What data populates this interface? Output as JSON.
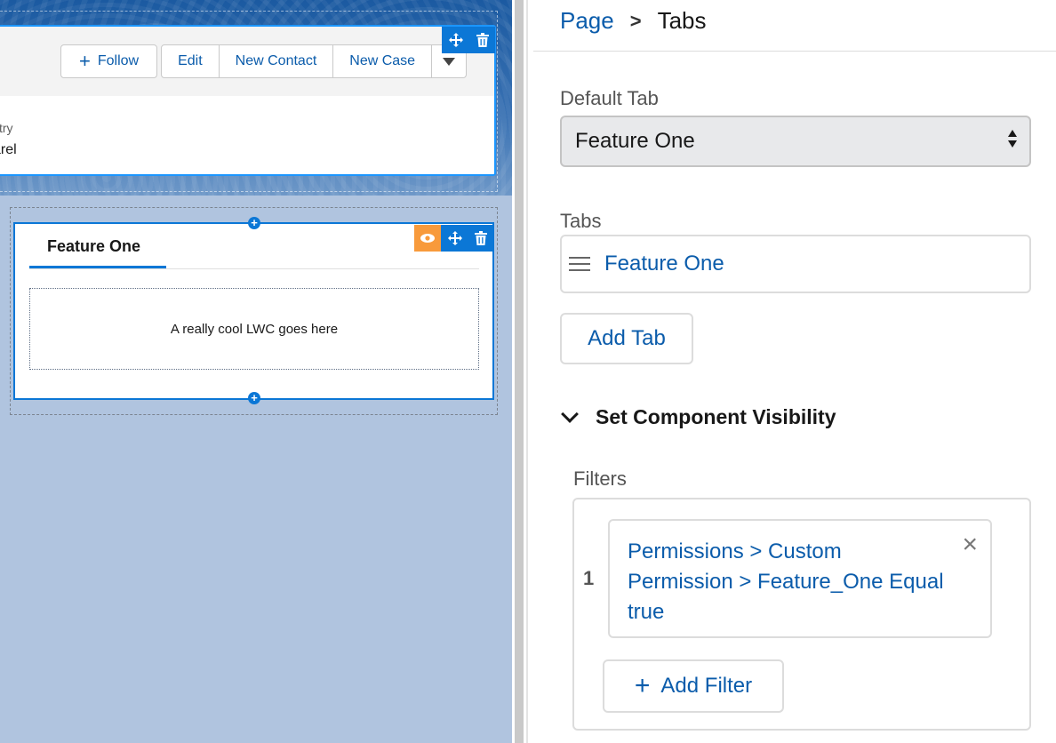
{
  "record_header": {
    "follow_label": "Follow",
    "edit_label": "Edit",
    "new_contact_label": "New Contact",
    "new_case_label": "New Case",
    "field_label": "stry",
    "field_value": "arel"
  },
  "tabs_component": {
    "tab_label": "Feature One",
    "placeholder_text": "A really cool LWC goes here"
  },
  "panel": {
    "breadcrumb": {
      "parent": "Page",
      "separator": ">",
      "current": "Tabs"
    },
    "default_tab": {
      "label": "Default Tab",
      "value": "Feature One"
    },
    "tabs": {
      "label": "Tabs",
      "items": [
        "Feature One"
      ],
      "add_label": "Add Tab"
    },
    "visibility": {
      "title": "Set Component Visibility",
      "filters_label": "Filters",
      "filters": [
        {
          "number": "1",
          "text": "Permissions > Custom Permission > Feature_One Equal true"
        }
      ],
      "add_filter_label": "Add Filter"
    }
  },
  "colors": {
    "link_blue": "#0b5cab",
    "brand_blue": "#0b77d6",
    "visibility_orange": "#f89a3b",
    "canvas_bg": "#b0c4df"
  },
  "icons": [
    "plus-icon",
    "caret-down-icon",
    "move-icon",
    "trash-icon",
    "eye-icon",
    "add-component-icon",
    "hamburger-icon",
    "chevron-down-icon",
    "close-icon",
    "select-arrows-icon"
  ]
}
